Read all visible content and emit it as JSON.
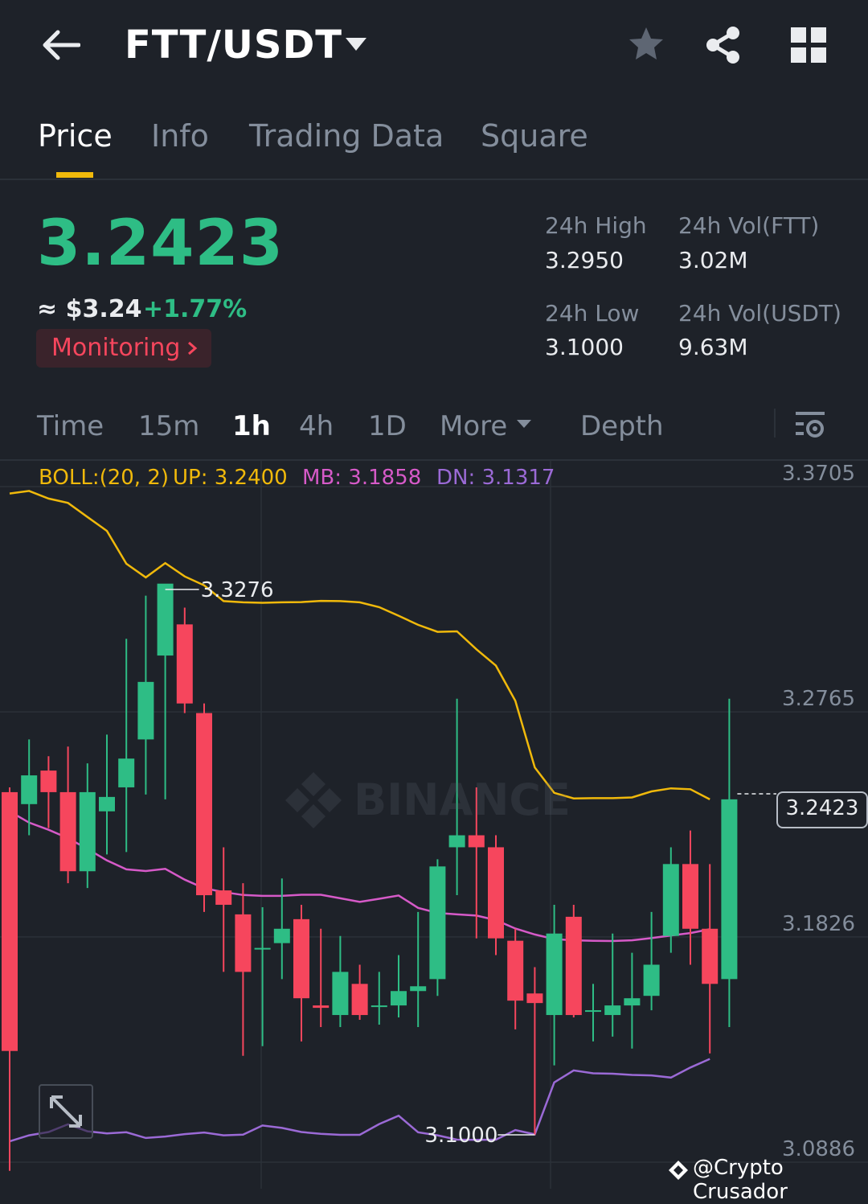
{
  "header": {
    "pair": "FTT/USDT",
    "back_icon": "arrow-left-icon",
    "favorite_icon": "star-icon",
    "share_icon": "share-icon",
    "menu_icon": "grid-icon"
  },
  "tabs": [
    {
      "label": "Price",
      "active": true
    },
    {
      "label": "Info"
    },
    {
      "label": "Trading Data"
    },
    {
      "label": "Square"
    }
  ],
  "price": {
    "last": "3.2423",
    "usd": "≈ $3.24",
    "change": "+1.77%",
    "monitor_label": "Monitoring",
    "up_color": "#2ebd85",
    "down_color": "#f6465d"
  },
  "stats": {
    "high_label": "24h High",
    "high_value": "3.2950",
    "low_label": "24h Low",
    "low_value": "3.1000",
    "vol_base_label": "24h Vol(FTT)",
    "vol_base_value": "3.02M",
    "vol_quote_label": "24h Vol(USDT)",
    "vol_quote_value": "9.63M"
  },
  "intervals": {
    "items": [
      "Time",
      "15m",
      "1h",
      "4h",
      "1D",
      "More",
      "Depth"
    ],
    "active": "1h"
  },
  "indicator": {
    "name": "BOLL:(20, 2)",
    "up": "UP: 3.2400",
    "mb": "MB: 3.1858",
    "dn": "DN: 3.1317",
    "colors": {
      "name": "#f0b90b",
      "up": "#f0b90b",
      "mb": "#d65ac8",
      "dn": "#9b6ad6"
    }
  },
  "chart_data": {
    "type": "candlestick",
    "y_ticks": [
      "3.3705",
      "3.2765",
      "3.1826",
      "3.0886"
    ],
    "current_price_label": "3.2423",
    "high_marker": "3.3276",
    "low_marker": "3.1000",
    "candles": [
      [
        3.243,
        3.135,
        3.245,
        3.085
      ],
      [
        3.238,
        3.25,
        3.265,
        3.225
      ],
      [
        3.252,
        3.243,
        3.258,
        3.228
      ],
      [
        3.243,
        3.21,
        3.262,
        3.205
      ],
      [
        3.21,
        3.243,
        3.255,
        3.203
      ],
      [
        3.235,
        3.241,
        3.267,
        3.217
      ],
      [
        3.245,
        3.257,
        3.307,
        3.218
      ],
      [
        3.265,
        3.289,
        3.325,
        3.242
      ],
      [
        3.3,
        3.33,
        3.328,
        3.24
      ],
      [
        3.313,
        3.28,
        3.32,
        3.276
      ],
      [
        3.276,
        3.2,
        3.28,
        3.193
      ],
      [
        3.202,
        3.196,
        3.22,
        3.168
      ],
      [
        3.192,
        3.168,
        3.205,
        3.133
      ],
      [
        3.178,
        3.178,
        3.195,
        3.137
      ],
      [
        3.18,
        3.186,
        3.207,
        3.165
      ],
      [
        3.19,
        3.157,
        3.196,
        3.139
      ],
      [
        3.154,
        3.153,
        3.186,
        3.145
      ],
      [
        3.15,
        3.168,
        3.183,
        3.145
      ],
      [
        3.163,
        3.15,
        3.171,
        3.148
      ],
      [
        3.154,
        3.154,
        3.168,
        3.146
      ],
      [
        3.154,
        3.16,
        3.175,
        3.149
      ],
      [
        3.16,
        3.162,
        3.193,
        3.145
      ],
      [
        3.165,
        3.212,
        3.215,
        3.158
      ],
      [
        3.22,
        3.225,
        3.282,
        3.2
      ],
      [
        3.225,
        3.22,
        3.245,
        3.182
      ],
      [
        3.22,
        3.182,
        3.225,
        3.175
      ],
      [
        3.181,
        3.156,
        3.186,
        3.144
      ],
      [
        3.159,
        3.155,
        3.17,
        3.1
      ],
      [
        3.15,
        3.184,
        3.196,
        3.129
      ],
      [
        3.191,
        3.15,
        3.196,
        3.149
      ],
      [
        3.152,
        3.152,
        3.163,
        3.139
      ],
      [
        3.15,
        3.154,
        3.184,
        3.141
      ],
      [
        3.154,
        3.157,
        3.176,
        3.136
      ],
      [
        3.158,
        3.171,
        3.193,
        3.152
      ],
      [
        3.183,
        3.213,
        3.22,
        3.176
      ],
      [
        3.213,
        3.186,
        3.227,
        3.171
      ],
      [
        3.186,
        3.163,
        3.213,
        3.134
      ],
      [
        3.165,
        3.24,
        3.282,
        3.145
      ]
    ],
    "candle_fields": [
      "open",
      "close",
      "high",
      "low"
    ],
    "boll_up": [
      3.3676,
      3.3687,
      3.3655,
      3.3637,
      3.3578,
      3.352,
      3.3383,
      3.3326,
      3.3386,
      3.333,
      3.3293,
      3.3227,
      3.3222,
      3.322,
      3.3222,
      3.3223,
      3.3228,
      3.3227,
      3.3222,
      3.3202,
      3.3166,
      3.3128,
      3.3099,
      3.3101,
      3.3026,
      3.2958,
      3.2811,
      3.2533,
      3.2427,
      3.2404,
      3.2405,
      3.2405,
      3.2408,
      3.2433,
      3.2446,
      3.2442,
      3.24
    ],
    "boll_mb": [
      3.235,
      3.2303,
      3.2273,
      3.2238,
      3.2193,
      3.2145,
      3.2108,
      3.2101,
      3.211,
      3.2065,
      3.2029,
      3.2013,
      3.2001,
      3.1997,
      3.1997,
      3.2002,
      3.2002,
      3.1987,
      3.1972,
      3.1985,
      3.1999,
      3.1947,
      3.1926,
      3.192,
      3.1915,
      3.1896,
      3.1861,
      3.1836,
      3.1817,
      3.1812,
      3.181,
      3.1809,
      3.1812,
      3.1821,
      3.1832,
      3.1842,
      3.1858
    ],
    "boll_dn": [
      3.0973,
      3.0998,
      3.1012,
      3.1044,
      3.1015,
      3.1006,
      3.1011,
      3.0987,
      3.0993,
      3.1003,
      3.101,
      3.0998,
      3.1001,
      3.1039,
      3.1029,
      3.1012,
      3.1004,
      3.1,
      3.1,
      3.1045,
      3.108,
      3.1011,
      3.0998,
      3.098,
      3.0979,
      3.098,
      3.102,
      3.1002,
      3.1219,
      3.1269,
      3.1257,
      3.1255,
      3.125,
      3.1248,
      3.1239,
      3.1281,
      3.1317
    ],
    "y_axis_range": [
      3.0886,
      3.3705
    ]
  },
  "footer": {
    "expand_icon": "expand-icon",
    "watermark": "@Crypto Crusador",
    "bg_logo": "BINANCE"
  }
}
